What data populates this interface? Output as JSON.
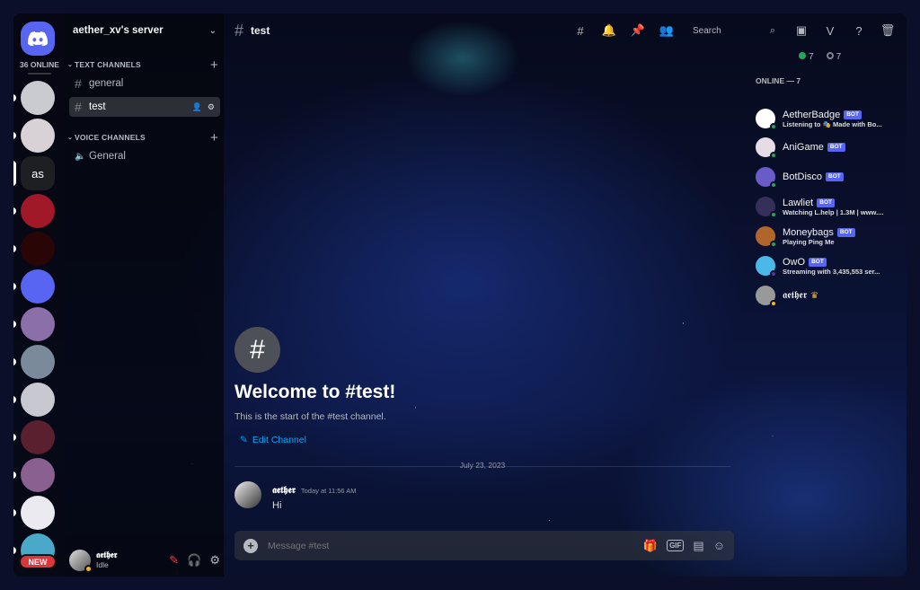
{
  "rail": {
    "online_count": "36 ONLINE",
    "dm_icon": "discord-logo-icon",
    "servers": [
      {
        "label": "",
        "color": "#c9cbd0"
      },
      {
        "label": "",
        "color": "#d8d2d6"
      },
      {
        "label": "as",
        "color": "#1e1f22"
      },
      {
        "label": "",
        "color": "#a11828"
      },
      {
        "label": "",
        "color": "#2a0505"
      },
      {
        "label": "",
        "color": "#5865f2"
      },
      {
        "label": "",
        "color": "#8a6fa8"
      },
      {
        "label": "",
        "color": "#7a8a9a"
      },
      {
        "label": "",
        "color": "#c8c8d0"
      },
      {
        "label": "",
        "color": "#5a2030"
      },
      {
        "label": "",
        "color": "#8a6090"
      },
      {
        "label": "",
        "color": "#eaeaf0"
      },
      {
        "label": "",
        "color": "#4aa8c8"
      }
    ],
    "new_badge": "NEW"
  },
  "server": {
    "name": "aether_xv's server",
    "text_category": "TEXT CHANNELS",
    "voice_category": "VOICE CHANNELS",
    "text_channels": [
      "general",
      "test"
    ],
    "voice_channels": [
      "General"
    ]
  },
  "user": {
    "name": "𝖆𝖊𝖙𝖍𝖊𝖗",
    "status": "Idle"
  },
  "topbar": {
    "channel": "test",
    "search_placeholder": "Search"
  },
  "welcome": {
    "title": "Welcome to #test!",
    "subtitle": "This is the start of the #test channel.",
    "edit": "Edit Channel"
  },
  "messages": {
    "date": "July 23, 2023",
    "author": "𝖆𝖊𝖙𝖍𝖊𝖗",
    "time": "Today at 11:56 AM",
    "text": "Hi"
  },
  "composer": {
    "placeholder": "Message #test",
    "gif": "GIF"
  },
  "members": {
    "online_stat": "7",
    "offline_stat": "7",
    "header": "ONLINE — 7",
    "bot_label": "BOT",
    "list": [
      {
        "name": "AetherBadge",
        "activity": "Listening to 🎭 Made with Bo...",
        "color": "#ffffff",
        "status": "#23a55a",
        "bot": true
      },
      {
        "name": "AniGame",
        "activity": "",
        "color": "#e6dce6",
        "status": "#23a55a",
        "bot": true
      },
      {
        "name": "BotDisco",
        "activity": "",
        "color": "#6a5cc8",
        "status": "#23a55a",
        "bot": true
      },
      {
        "name": "Lawliet",
        "activity": "Watching L.help | 1.3M | www....",
        "color": "#34305a",
        "status": "#23a55a",
        "bot": true
      },
      {
        "name": "Moneybags",
        "activity": "Playing Ping Me",
        "color": "#b0662a",
        "status": "#23a55a",
        "bot": true
      },
      {
        "name": "OwO",
        "activity": "Streaming with 3,435,553 ser...",
        "color": "#4ab8e8",
        "status": "#593695",
        "bot": true
      },
      {
        "name": "𝖆𝖊𝖙𝖍𝖊𝖗",
        "activity": "",
        "color": "#999999",
        "status": "#f0b232",
        "bot": false
      }
    ]
  }
}
